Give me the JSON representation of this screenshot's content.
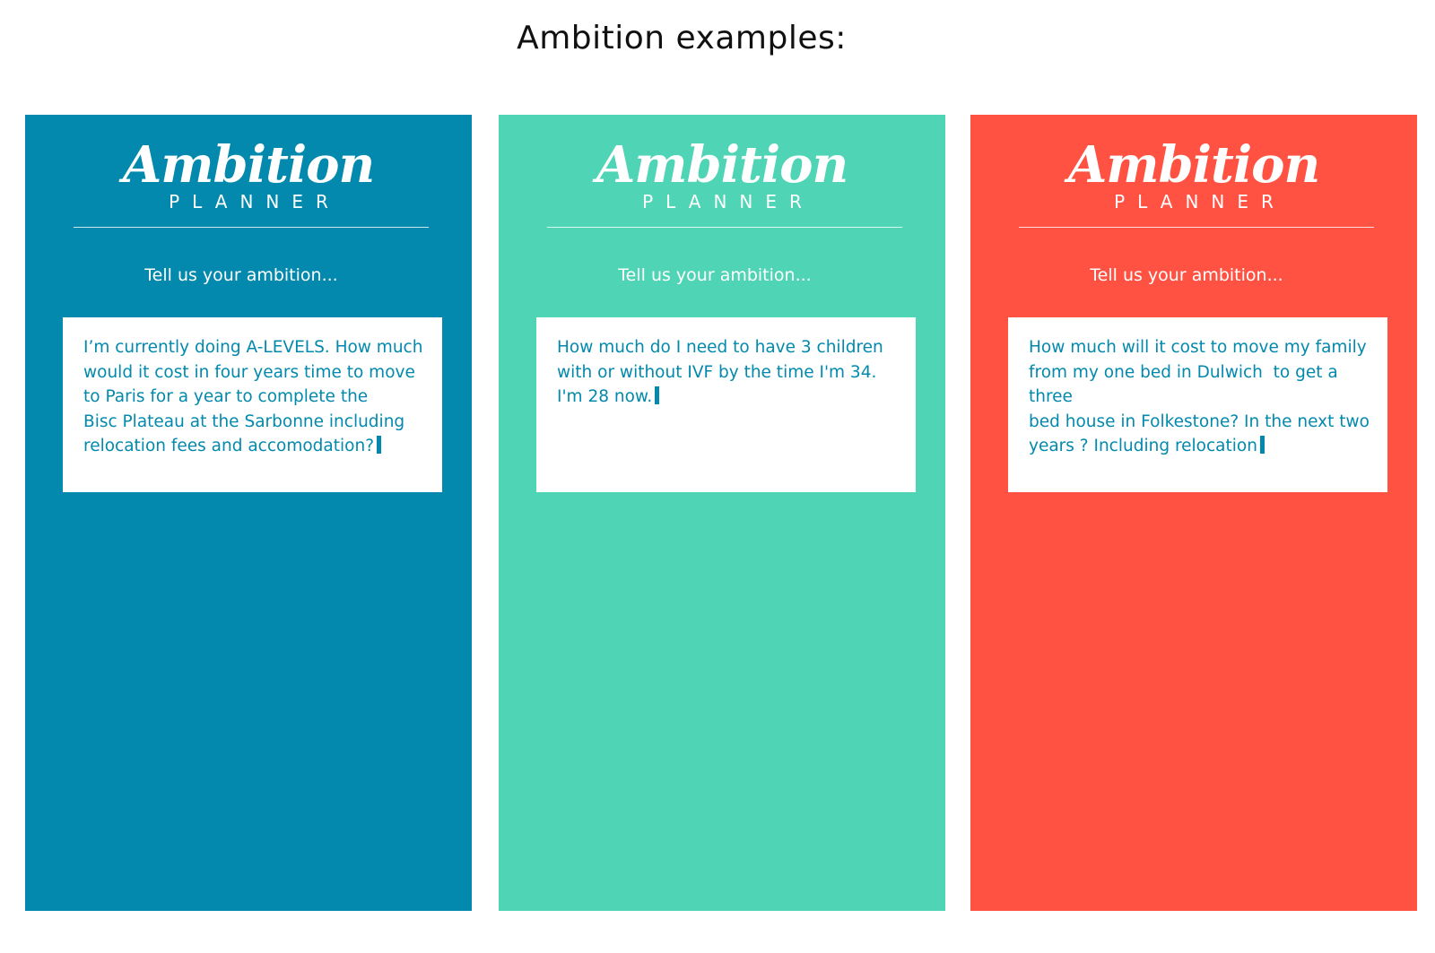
{
  "page": {
    "title": "Ambition examples:"
  },
  "cards": [
    {
      "background": "#0289AD",
      "text_color": "#0289AD",
      "logo_script": "Ambition",
      "logo_sub": "PLANNER",
      "prompt": "Tell us your ambition...",
      "input_value": "I’m currently doing A-LEVELS. How much\nwould it cost in four years time to move\nto Paris for a year to complete the\nBisc Plateau at the Sarbonne including\nrelocation fees and accomodation?"
    },
    {
      "background": "#4FD4B5",
      "text_color": "#0289AD",
      "logo_script": "Ambition",
      "logo_sub": "PLANNER",
      "prompt": "Tell us your ambition...",
      "input_value": "How much do I need to have 3 children\nwith or without IVF by the time I'm 34.\nI'm 28 now."
    },
    {
      "background": "#FF5242",
      "text_color": "#0289AD",
      "logo_script": "Ambition",
      "logo_sub": "PLANNER",
      "prompt": "Tell us your ambition...",
      "input_value": "How much will it cost to move my family\nfrom my one bed in Dulwich  to get a three\nbed house in Folkestone? In the next two\nyears ? Including relocation"
    }
  ]
}
